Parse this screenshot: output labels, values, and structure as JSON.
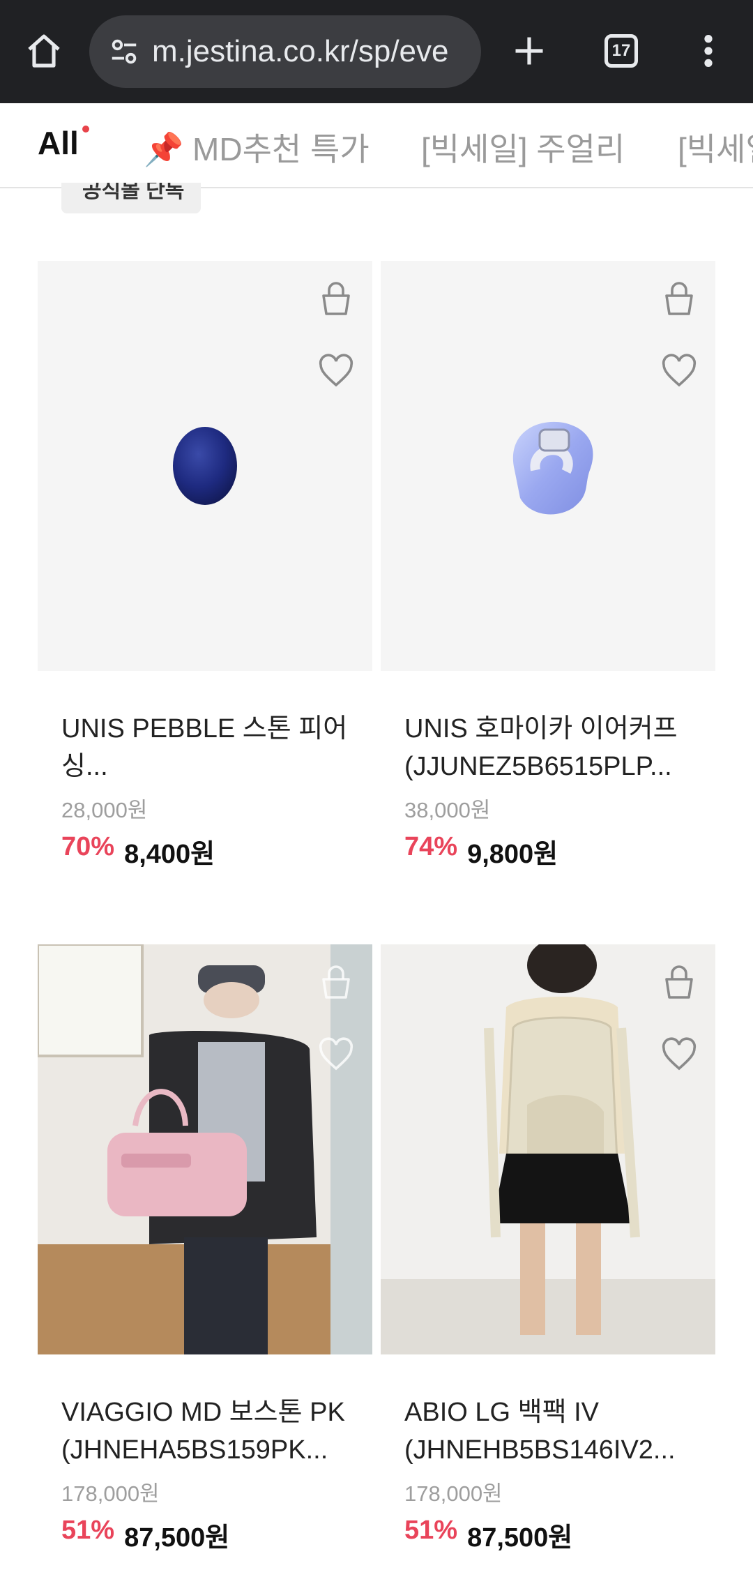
{
  "browser": {
    "url": "m.jestina.co.kr/sp/eve",
    "tab_count": "17"
  },
  "category_tabs": [
    {
      "label": "All",
      "active": true
    },
    {
      "label": "📌 MD추천 특가",
      "active": false
    },
    {
      "label": "[빅세일] 주얼리",
      "active": false
    },
    {
      "label": "[빅세일",
      "active": false
    }
  ],
  "peek_tag": "공식몰 단독",
  "products": [
    {
      "name": "UNIS PEBBLE 스톤 피어싱...",
      "original_price": "28,000원",
      "discount": "70%",
      "sale_price": "8,400원"
    },
    {
      "name": "UNIS 호마이카 이어커프 (JJUNEZ5B6515PLP...",
      "original_price": "38,000원",
      "discount": "74%",
      "sale_price": "9,800원"
    },
    {
      "name": "VIAGGIO MD 보스톤 PK (JHNEHA5BS159PK...",
      "original_price": "178,000원",
      "discount": "51%",
      "sale_price": "87,500원"
    },
    {
      "name": "ABIO LG 백팩 IV (JHNEHB5BS146IV2...",
      "original_price": "178,000원",
      "discount": "51%",
      "sale_price": "87,500원"
    }
  ],
  "colors": {
    "discount": "#e9445a",
    "browser_bg": "#202124",
    "card_bg": "#f5f5f5"
  },
  "icons": [
    "home-icon",
    "site-settings-icon",
    "plus-icon",
    "tab-switcher-icon",
    "more-vert-icon",
    "cart-icon",
    "heart-icon"
  ]
}
